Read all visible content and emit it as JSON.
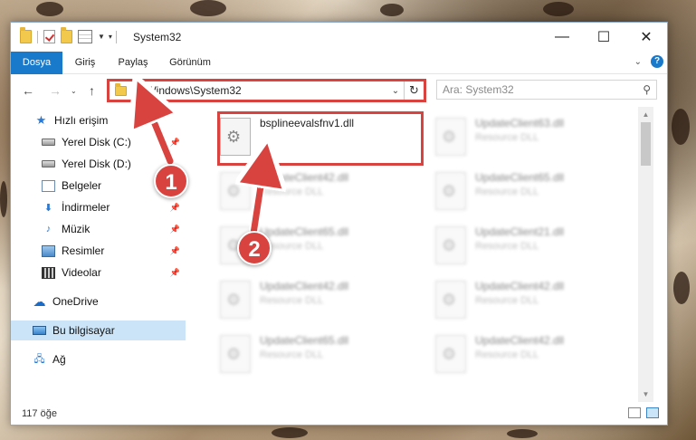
{
  "window": {
    "title": "System32",
    "minimize": "—",
    "maximize": "☐",
    "close": "✕"
  },
  "ribbon": {
    "tabs": [
      "Dosya",
      "Giriş",
      "Paylaş",
      "Görünüm"
    ]
  },
  "nav": {
    "back": "←",
    "forward": "→",
    "up": "↑",
    "address": "C:\\Windows\\System32",
    "search_placeholder": "Ara: System32"
  },
  "sidebar": {
    "items": [
      {
        "label": "Hızlı erişim",
        "icon": "star-icon"
      },
      {
        "label": "Yerel Disk (C:)",
        "icon": "drive-icon",
        "pinned": true
      },
      {
        "label": "Yerel Disk (D:)",
        "icon": "drive-icon"
      },
      {
        "label": "Belgeler",
        "icon": "document-icon",
        "pinned": true
      },
      {
        "label": "İndirmeler",
        "icon": "download-icon",
        "pinned": true
      },
      {
        "label": "Müzik",
        "icon": "music-icon",
        "pinned": true
      },
      {
        "label": "Resimler",
        "icon": "pictures-icon",
        "pinned": true
      },
      {
        "label": "Videolar",
        "icon": "video-icon",
        "pinned": true
      },
      {
        "label": "OneDrive",
        "icon": "cloud-icon"
      },
      {
        "label": "Bu bilgisayar",
        "icon": "computer-icon",
        "selected": true
      },
      {
        "label": "Ağ",
        "icon": "network-icon"
      }
    ]
  },
  "files": [
    {
      "name": "bsplineevalsfnv1.dll",
      "type": "",
      "highlighted": true
    },
    {
      "name": "UpdateClient63.dll",
      "type": "Resource DLL"
    },
    {
      "name": "UpdateClient42.dll",
      "type": "Resource DLL"
    },
    {
      "name": "UpdateClient65.dll",
      "type": "Resource DLL"
    },
    {
      "name": "UpdateClient65.dll",
      "type": "Resource DLL"
    },
    {
      "name": "UpdateClient21.dll",
      "type": "Resource DLL"
    },
    {
      "name": "UpdateClient42.dll",
      "type": "Resource DLL"
    },
    {
      "name": "UpdateClient42.dll",
      "type": "Resource DLL"
    },
    {
      "name": "UpdateClient65.dll",
      "type": "Resource DLL"
    },
    {
      "name": "UpdateClient42.dll",
      "type": "Resource DLL"
    }
  ],
  "status": {
    "count": "117 öğe"
  },
  "annotations": {
    "step1": "1",
    "step2": "2",
    "accent_color": "#d9433f"
  }
}
